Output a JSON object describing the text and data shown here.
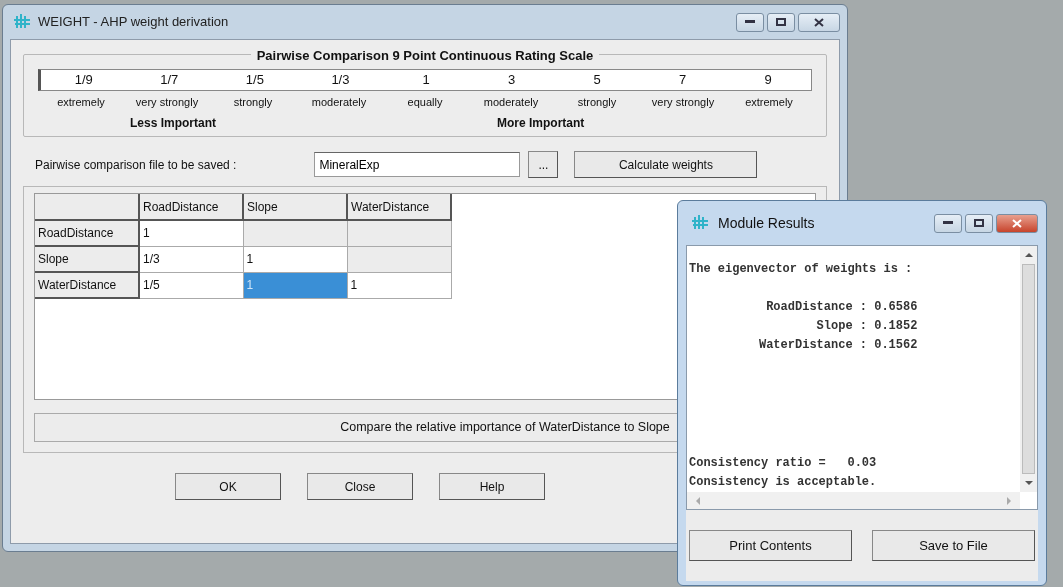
{
  "main_window": {
    "title": "WEIGHT - AHP weight derivation",
    "scale": {
      "title": "Pairwise Comparison 9 Point Continuous Rating Scale",
      "points": [
        {
          "value": "1/9",
          "label": "extremely"
        },
        {
          "value": "1/7",
          "label": "very strongly"
        },
        {
          "value": "1/5",
          "label": "strongly"
        },
        {
          "value": "1/3",
          "label": "moderately"
        },
        {
          "value": "1",
          "label": "equally"
        },
        {
          "value": "3",
          "label": "moderately"
        },
        {
          "value": "5",
          "label": "strongly"
        },
        {
          "value": "7",
          "label": "very strongly"
        },
        {
          "value": "9",
          "label": "extremely"
        }
      ],
      "less_label": "Less Important",
      "more_label": "More Important"
    },
    "file": {
      "label": "Pairwise comparison file to be saved :",
      "value": "MineralExp",
      "browse_button": "...",
      "calculate_button": "Calculate weights"
    },
    "grid": {
      "columns": [
        "RoadDistance",
        "Slope",
        "WaterDistance"
      ],
      "rows": [
        {
          "label": "RoadDistance",
          "cells": [
            {
              "value": "1",
              "disabled": false,
              "selected": false
            },
            {
              "disabled": true,
              "selected": false
            },
            {
              "disabled": true,
              "selected": false
            }
          ]
        },
        {
          "label": "Slope",
          "cells": [
            {
              "value": "1/3",
              "disabled": false,
              "selected": false
            },
            {
              "value": "1",
              "disabled": false,
              "selected": false
            },
            {
              "disabled": true,
              "selected": false
            }
          ]
        },
        {
          "label": "WaterDistance",
          "cells": [
            {
              "value": "1/5",
              "disabled": false,
              "selected": false
            },
            {
              "value": "1",
              "disabled": false,
              "selected": true
            },
            {
              "value": "1",
              "disabled": false,
              "selected": false
            }
          ]
        }
      ]
    },
    "status": "Compare the relative importance of WaterDistance to Slope",
    "buttons": [
      "OK",
      "Close",
      "Help"
    ]
  },
  "results_window": {
    "title": "Module Results",
    "heading": "The eigenvector of weights is :",
    "weights": [
      {
        "name": "RoadDistance :",
        "value": "0.6586"
      },
      {
        "name": "Slope :",
        "value": "0.1852"
      },
      {
        "name": "WaterDistance :",
        "value": "0.1562"
      }
    ],
    "lines": [
      "Consistency ratio =   0.03",
      "Consistency is acceptable."
    ],
    "buttons": [
      "Print Contents",
      "Save to File"
    ]
  }
}
